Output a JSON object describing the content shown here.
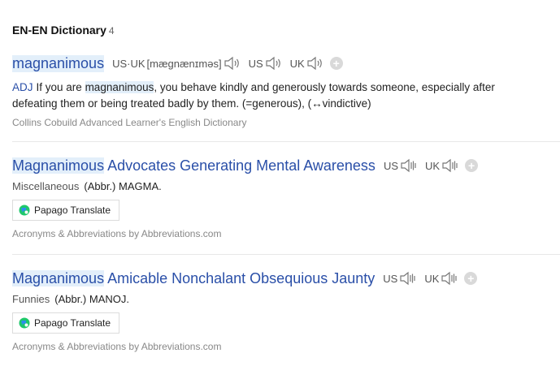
{
  "section": {
    "title": "EN-EN Dictionary",
    "count": "4"
  },
  "entries": [
    {
      "word": "magnanimous",
      "pron_label": "US·UK",
      "pron_text": "[mæɡnænɪməs]",
      "us_label": "US",
      "uk_label": "UK",
      "pos": "ADJ",
      "def_pre": "If you are ",
      "def_hl": "magnanimous",
      "def_post": ", you behave kindly and generously towards someone, especially after defeating them or being treated badly by them. (=generous), (↔vindictive)",
      "source": "Collins Cobuild Advanced Learner's English Dictionary"
    },
    {
      "title_hl": "Magnanimous",
      "title_rest": " Advocates Generating Mental Awareness",
      "us_label": "US",
      "uk_label": "UK",
      "category": "Miscellaneous",
      "abbr": "(Abbr.) MAGMA.",
      "translate_label": "Papago Translate",
      "source": "Acronyms & Abbreviations by Abbreviations.com"
    },
    {
      "title_hl": "Magnanimous",
      "title_rest": " Amicable Nonchalant Obsequious Jaunty",
      "us_label": "US",
      "uk_label": "UK",
      "category": "Funnies",
      "abbr": "(Abbr.) MANOJ.",
      "translate_label": "Papago Translate",
      "source": "Acronyms & Abbreviations by Abbreviations.com"
    }
  ],
  "colors": {
    "link": "#2a4fa8",
    "highlight": "#e3effa",
    "papago_green": "#1ec86b",
    "papago_blue": "#2e8cf0"
  },
  "icons": {
    "speaker": "speaker-icon",
    "add": "plus-icon",
    "papago": "papago-logo-icon"
  }
}
